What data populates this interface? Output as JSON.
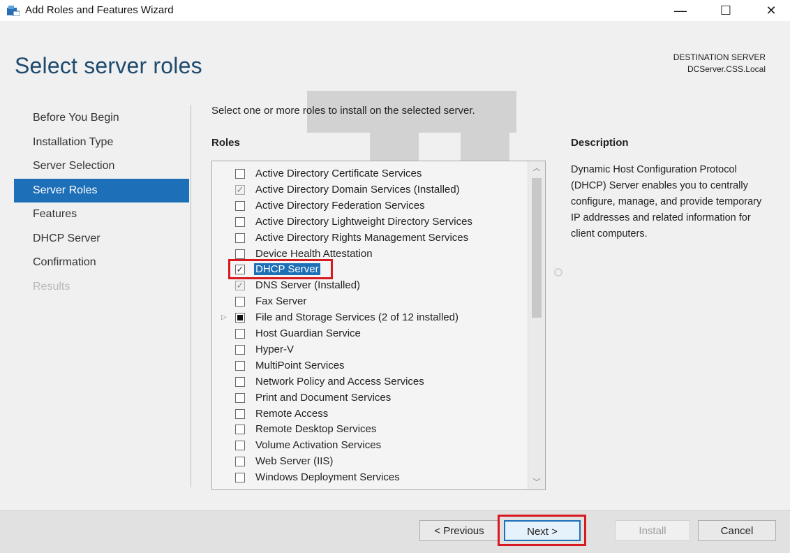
{
  "window": {
    "title": "Add Roles and Features Wizard",
    "controls": {
      "minimize": "—",
      "maximize": "☐",
      "close": "✕"
    }
  },
  "header": {
    "page_title": "Select server roles",
    "destination_label": "DESTINATION SERVER",
    "destination_server": "DCServer.CSS.Local"
  },
  "nav": {
    "items": [
      {
        "label": "Before You Begin",
        "state": "normal"
      },
      {
        "label": "Installation Type",
        "state": "normal"
      },
      {
        "label": "Server Selection",
        "state": "normal"
      },
      {
        "label": "Server Roles",
        "state": "active"
      },
      {
        "label": "Features",
        "state": "normal"
      },
      {
        "label": "DHCP Server",
        "state": "normal"
      },
      {
        "label": "Confirmation",
        "state": "normal"
      },
      {
        "label": "Results",
        "state": "disabled"
      }
    ]
  },
  "main": {
    "intro": "Select one or more roles to install on the selected server.",
    "roles_heading": "Roles",
    "description_heading": "Description",
    "description_text": "Dynamic Host Configuration Protocol (DHCP) Server enables you to centrally configure, manage, and provide temporary IP addresses and related information for client computers.",
    "roles": [
      {
        "label": "Active Directory Certificate Services",
        "state": "unchecked"
      },
      {
        "label": "Active Directory Domain Services (Installed)",
        "state": "installed"
      },
      {
        "label": "Active Directory Federation Services",
        "state": "unchecked"
      },
      {
        "label": "Active Directory Lightweight Directory Services",
        "state": "unchecked"
      },
      {
        "label": "Active Directory Rights Management Services",
        "state": "unchecked"
      },
      {
        "label": "Device Health Attestation",
        "state": "unchecked"
      },
      {
        "label": "DHCP Server",
        "state": "checked",
        "selected": true
      },
      {
        "label": "DNS Server (Installed)",
        "state": "installed"
      },
      {
        "label": "Fax Server",
        "state": "unchecked"
      },
      {
        "label": "File and Storage Services (2 of 12 installed)",
        "state": "partial",
        "expandable": true
      },
      {
        "label": "Host Guardian Service",
        "state": "unchecked"
      },
      {
        "label": "Hyper-V",
        "state": "unchecked"
      },
      {
        "label": "MultiPoint Services",
        "state": "unchecked"
      },
      {
        "label": "Network Policy and Access Services",
        "state": "unchecked"
      },
      {
        "label": "Print and Document Services",
        "state": "unchecked"
      },
      {
        "label": "Remote Access",
        "state": "unchecked"
      },
      {
        "label": "Remote Desktop Services",
        "state": "unchecked"
      },
      {
        "label": "Volume Activation Services",
        "state": "unchecked"
      },
      {
        "label": "Web Server (IIS)",
        "state": "unchecked"
      },
      {
        "label": "Windows Deployment Services",
        "state": "unchecked"
      }
    ]
  },
  "footer": {
    "previous": "< Previous",
    "next": "Next >",
    "install": "Install",
    "cancel": "Cancel"
  },
  "watermark_text": "TECH",
  "colors": {
    "accent": "#1d6fb8",
    "title_blue": "#1e4a6e",
    "highlight_red": "#d71920"
  }
}
